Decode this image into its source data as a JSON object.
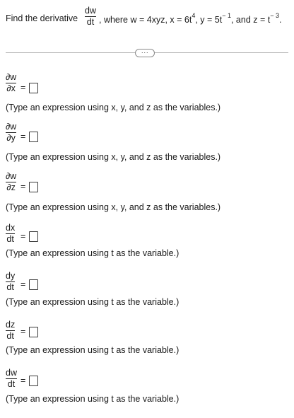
{
  "question": {
    "prefix": "Find the derivative",
    "main_frac_num": "dw",
    "main_frac_den": "dt",
    "where": ", where w = 4xyz, x = 6t",
    "x_exp": "4",
    "y_part": ", y = 5t",
    "y_exp": "− 1",
    "z_part": ", and z = t",
    "z_exp": "− 3",
    "end": "."
  },
  "more_button_label": "···",
  "parts": [
    {
      "num": "∂w",
      "den": "∂x",
      "eq": "=",
      "hint": "(Type an expression using x, y, and z as the variables.)"
    },
    {
      "num": "∂w",
      "den": "∂y",
      "eq": "=",
      "hint": "(Type an expression using x, y, and z as the variables.)"
    },
    {
      "num": "∂w",
      "den": "∂z",
      "eq": "=",
      "hint": "(Type an expression using x, y, and z as the variables.)"
    },
    {
      "num": "dx",
      "den": "dt",
      "eq": "=",
      "hint": "(Type an expression using t as the variable.)"
    },
    {
      "num": "dy",
      "den": "dt",
      "eq": "=",
      "hint": "(Type an expression using t as the variable.)"
    },
    {
      "num": "dz",
      "den": "dt",
      "eq": "=",
      "hint": "(Type an expression using t as the variable.)"
    },
    {
      "num": "dw",
      "den": "dt",
      "eq": "=",
      "hint": "(Type an expression using t as the variable.)"
    }
  ]
}
